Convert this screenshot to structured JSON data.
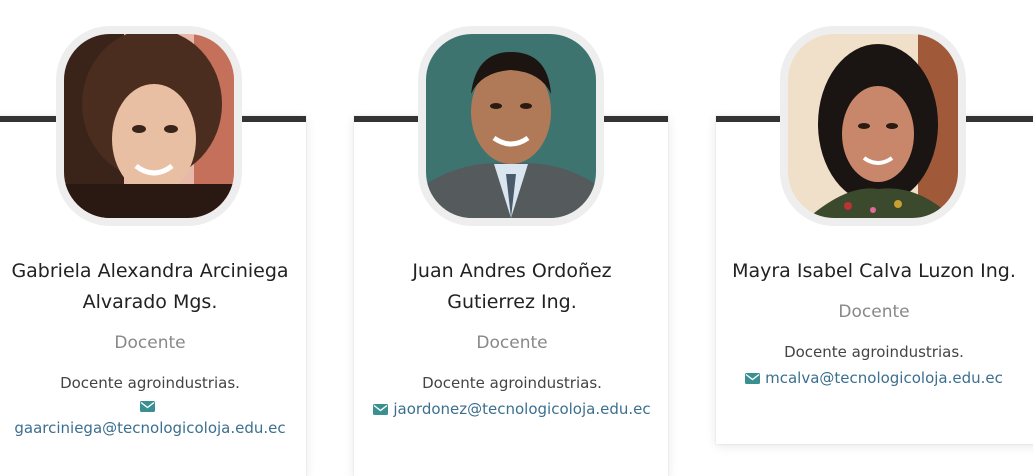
{
  "people": [
    {
      "name_line1": "Gabriela Alexandra Arciniega",
      "name_line2": "Alvarado Mgs.",
      "role": "Docente",
      "description": "Docente agroindustrias.",
      "email": "gaarciniega@tecnologicoloja.edu.ec"
    },
    {
      "name_line1": "Juan Andres Ordoñez",
      "name_line2": "Gutierrez Ing.",
      "role": "Docente",
      "description": "Docente agroindustrias.",
      "email": "jaordonez@tecnologicoloja.edu.ec"
    },
    {
      "name_line1": "Mayra Isabel Calva Luzon Ing.",
      "role": "Docente",
      "description": "Docente agroindustrias.",
      "email": "mcalva@tecnologicoloja.edu.ec"
    }
  ],
  "colors": {
    "accent_bar": "#333333",
    "email_link": "#3b6f8f",
    "role_text": "#888888"
  },
  "icons": {
    "email": "envelope-icon"
  }
}
